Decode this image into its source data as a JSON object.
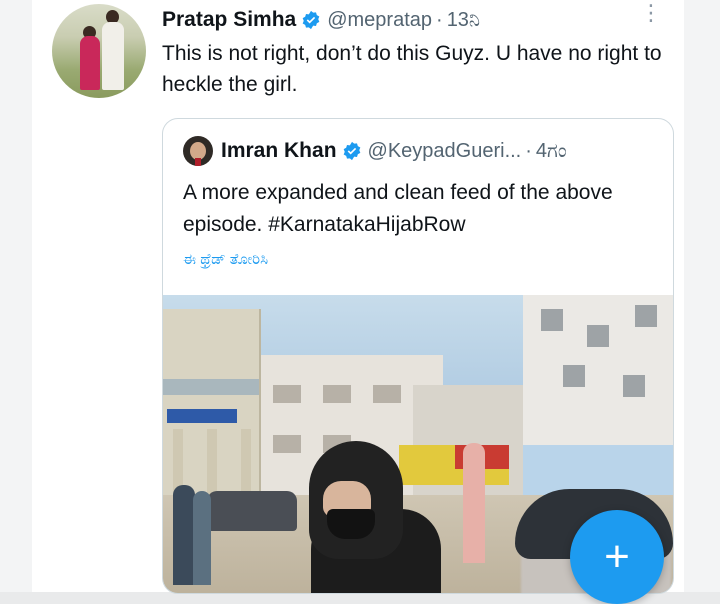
{
  "tweet": {
    "author": {
      "name": "Pratap Simha",
      "handle": "@mepratap",
      "time": "13ನಿ"
    },
    "separator": "·",
    "more_icon": "⋮",
    "text": "This is not right, don’t do this Guyz. U have no right to heckle the girl."
  },
  "quote": {
    "author": {
      "name": "Imran Khan",
      "handle": "@KeypadGueri...",
      "time": "4ಗಂ"
    },
    "separator": "·",
    "text": "A more expanded and clean feed of the above episode. #KarnatakaHijabRow",
    "translate_label": "ಈ ಥ್ರೆಡ್ ತೋರಿಸಿ"
  },
  "compose": {
    "icon": "+"
  },
  "colors": {
    "accent": "#1d9bf0",
    "secondary_text": "#536471",
    "border": "#cfd9de"
  },
  "icons": {
    "verified": "verified-badge-icon",
    "more": "more-options-icon",
    "compose": "compose-plus-icon"
  }
}
